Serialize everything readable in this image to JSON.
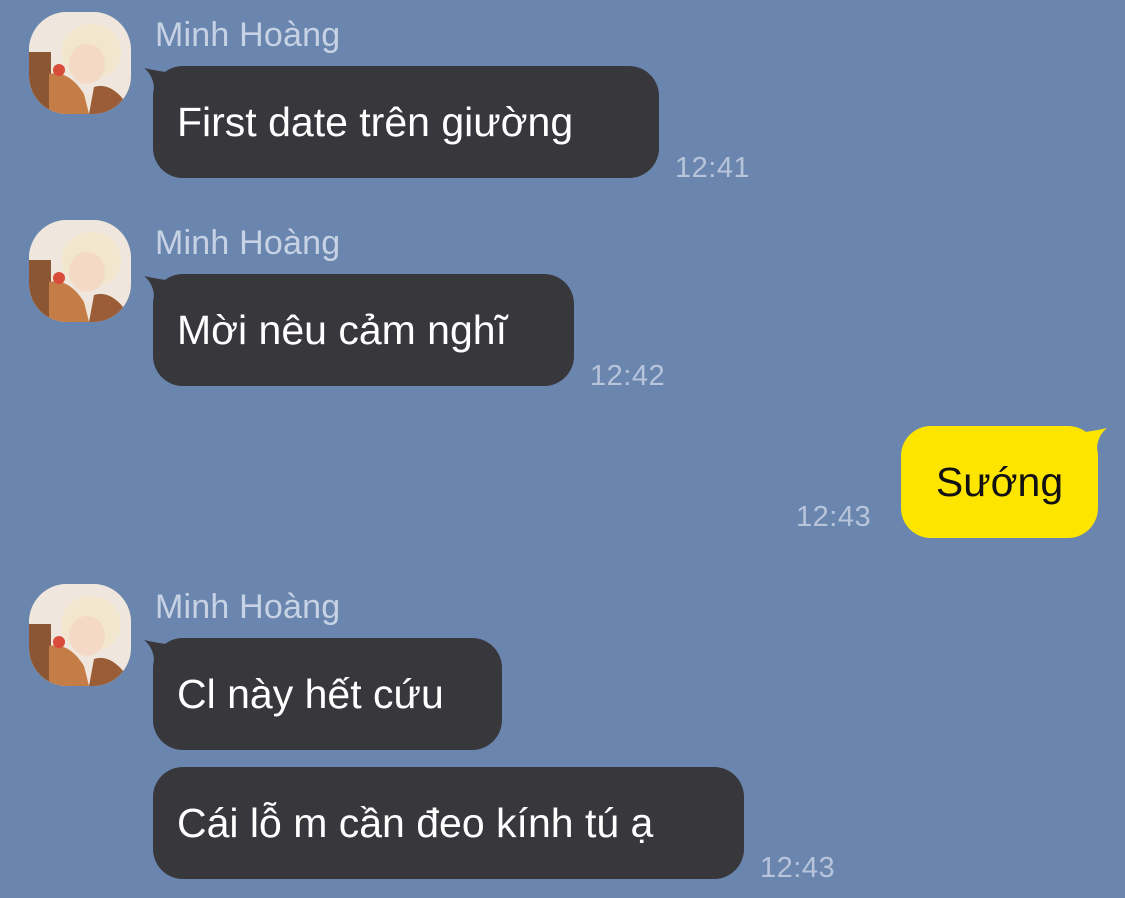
{
  "colors": {
    "background": "#6a86ae",
    "incoming_bubble": "#38373b",
    "outgoing_bubble": "#fee500",
    "sender_name": "#c7d2e5",
    "timestamp": "#b7c4da"
  },
  "messages": [
    {
      "sender": "Minh Hoàng",
      "avatar": "profile-photo",
      "text": "First date trên giường",
      "time": "12:41"
    },
    {
      "sender": "Minh Hoàng",
      "avatar": "profile-photo",
      "text": "Mời nêu cảm nghĩ",
      "time": "12:42"
    },
    {
      "direction": "outgoing",
      "text": "Sướng",
      "time": "12:43"
    },
    {
      "sender": "Minh Hoàng",
      "avatar": "profile-photo",
      "texts": [
        "Cl này hết cứu",
        "Cái lỗ m cần đeo kính tú ạ"
      ],
      "time": "12:43"
    }
  ]
}
